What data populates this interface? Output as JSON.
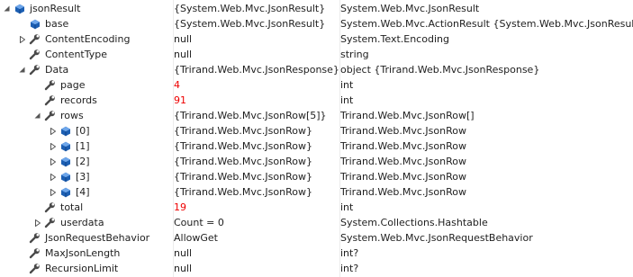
{
  "colors": {
    "changed_value": "#ee0000",
    "object_icon": "#1c5fb3",
    "wrench_icon": "#4a4a4a"
  },
  "rows": [
    {
      "depth": 0,
      "expander": "collapse",
      "icon": "object-icon",
      "name": "jsonResult",
      "value": "{System.Web.Mvc.JsonResult}",
      "type": "System.Web.Mvc.JsonResult",
      "changed": false
    },
    {
      "depth": 1,
      "expander": "none",
      "icon": "object-icon",
      "name": "base",
      "value": "{System.Web.Mvc.JsonResult}",
      "type": "System.Web.Mvc.ActionResult {System.Web.Mvc.JsonResult}",
      "changed": false
    },
    {
      "depth": 1,
      "expander": "expand",
      "icon": "wrench-icon",
      "name": "ContentEncoding",
      "value": "null",
      "type": "System.Text.Encoding",
      "changed": false
    },
    {
      "depth": 1,
      "expander": "none",
      "icon": "wrench-icon",
      "name": "ContentType",
      "value": "null",
      "type": "string",
      "changed": false
    },
    {
      "depth": 1,
      "expander": "collapse",
      "icon": "wrench-icon",
      "name": "Data",
      "value": "{Trirand.Web.Mvc.JsonResponse}",
      "type": "object {Trirand.Web.Mvc.JsonResponse}",
      "changed": false
    },
    {
      "depth": 2,
      "expander": "none",
      "icon": "wrench-icon",
      "name": "page",
      "value": "4",
      "type": "int",
      "changed": true
    },
    {
      "depth": 2,
      "expander": "none",
      "icon": "wrench-icon",
      "name": "records",
      "value": "91",
      "type": "int",
      "changed": true
    },
    {
      "depth": 2,
      "expander": "collapse",
      "icon": "wrench-icon",
      "name": "rows",
      "value": "{Trirand.Web.Mvc.JsonRow[5]}",
      "type": "Trirand.Web.Mvc.JsonRow[]",
      "changed": false
    },
    {
      "depth": 3,
      "expander": "expand",
      "icon": "object-icon",
      "name": "[0]",
      "value": "{Trirand.Web.Mvc.JsonRow}",
      "type": "Trirand.Web.Mvc.JsonRow",
      "changed": false
    },
    {
      "depth": 3,
      "expander": "expand",
      "icon": "object-icon",
      "name": "[1]",
      "value": "{Trirand.Web.Mvc.JsonRow}",
      "type": "Trirand.Web.Mvc.JsonRow",
      "changed": false
    },
    {
      "depth": 3,
      "expander": "expand",
      "icon": "object-icon",
      "name": "[2]",
      "value": "{Trirand.Web.Mvc.JsonRow}",
      "type": "Trirand.Web.Mvc.JsonRow",
      "changed": false
    },
    {
      "depth": 3,
      "expander": "expand",
      "icon": "object-icon",
      "name": "[3]",
      "value": "{Trirand.Web.Mvc.JsonRow}",
      "type": "Trirand.Web.Mvc.JsonRow",
      "changed": false
    },
    {
      "depth": 3,
      "expander": "expand",
      "icon": "object-icon",
      "name": "[4]",
      "value": "{Trirand.Web.Mvc.JsonRow}",
      "type": "Trirand.Web.Mvc.JsonRow",
      "changed": false
    },
    {
      "depth": 2,
      "expander": "none",
      "icon": "wrench-icon",
      "name": "total",
      "value": "19",
      "type": "int",
      "changed": true
    },
    {
      "depth": 2,
      "expander": "expand",
      "icon": "wrench-icon",
      "name": "userdata",
      "value": "Count = 0",
      "type": "System.Collections.Hashtable",
      "changed": false
    },
    {
      "depth": 1,
      "expander": "none",
      "icon": "wrench-icon",
      "name": "JsonRequestBehavior",
      "value": "AllowGet",
      "type": "System.Web.Mvc.JsonRequestBehavior",
      "changed": false
    },
    {
      "depth": 1,
      "expander": "none",
      "icon": "wrench-icon",
      "name": "MaxJsonLength",
      "value": "null",
      "type": "int?",
      "changed": false
    },
    {
      "depth": 1,
      "expander": "none",
      "icon": "wrench-icon",
      "name": "RecursionLimit",
      "value": "null",
      "type": "int?",
      "changed": false
    }
  ]
}
